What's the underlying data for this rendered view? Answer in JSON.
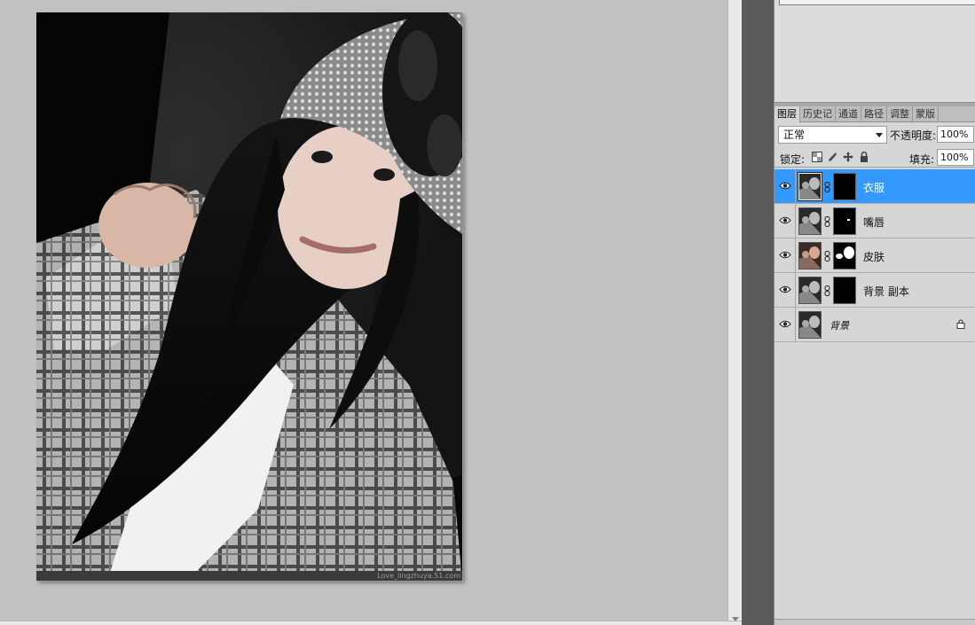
{
  "document": {
    "watermark": "Love_lingzhuya.51.com"
  },
  "top_panel": {
    "peek_text": "···"
  },
  "layers_panel": {
    "tabs": [
      {
        "label": "图层",
        "active": true
      },
      {
        "label": "历史记",
        "active": false
      },
      {
        "label": "通道",
        "active": false
      },
      {
        "label": "路径",
        "active": false
      },
      {
        "label": "调整",
        "active": false
      },
      {
        "label": "蒙版",
        "active": false
      }
    ],
    "blend_mode": "正常",
    "opacity_label": "不透明度:",
    "opacity_value": "100%",
    "lock_label": "锁定:",
    "fill_label": "填充:",
    "fill_value": "100%",
    "layers": [
      {
        "name": "衣服",
        "selected": true,
        "has_mask": true,
        "locked": false,
        "italic": false
      },
      {
        "name": "嘴唇",
        "selected": false,
        "has_mask": true,
        "locked": false,
        "italic": false
      },
      {
        "name": "皮肤",
        "selected": false,
        "has_mask": true,
        "locked": false,
        "italic": false
      },
      {
        "name": "背景 副本",
        "selected": false,
        "has_mask": true,
        "locked": false,
        "italic": false
      },
      {
        "name": "背景",
        "selected": false,
        "has_mask": false,
        "locked": true,
        "italic": true
      }
    ]
  },
  "colors": {
    "selection": "#3399ff",
    "canvas_bg": "#c1c1c1",
    "panel_bg": "#d6d6d6"
  }
}
